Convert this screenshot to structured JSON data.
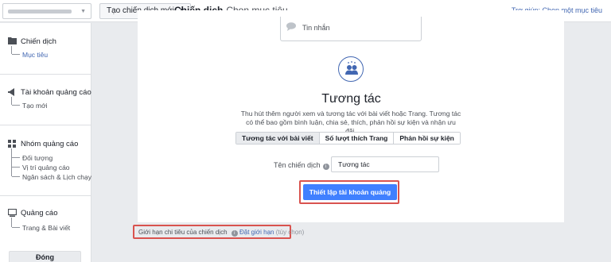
{
  "topbar": {
    "new_campaign_label": "Tạo chiến dịch mới",
    "campaign_bold": "Chiến dịch",
    "campaign_sub": "Chọn mục tiêu.",
    "help_link": "Trợ giúp: Chọn một mục tiêu"
  },
  "sidebar": {
    "campaign": {
      "title": "Chiến dịch",
      "items": [
        "Mục tiêu"
      ]
    },
    "ad_account": {
      "title": "Tài khoản quảng cáo",
      "items": [
        "Tạo mới"
      ]
    },
    "ad_set": {
      "title": "Nhóm quảng cáo",
      "items": [
        "Đối tượng",
        "Vị trí quảng cáo",
        "Ngân sách & Lịch chạy"
      ]
    },
    "ad": {
      "title": "Quảng cáo",
      "items": [
        "Trang & Bài viết"
      ]
    },
    "close_label": "Đóng"
  },
  "main": {
    "message_option": "Tin nhắn",
    "objective_title": "Tương tác",
    "objective_desc": "Thu hút thêm người xem và tương tác với bài viết hoặc Trang. Tương tác có thể bao gồm bình luận, chia sẻ, thích, phản hồi sự kiện và nhận ưu đãi.",
    "tabs": [
      "Tương tác với bài viết",
      "Số lượt thích Trang",
      "Phản hồi sự kiện"
    ],
    "campaign_name_label": "Tên chiến dịch",
    "campaign_name_value": "Tương tác",
    "setup_button": "Thiết lập tài khoản quảng cáo",
    "spend_limit_label": "Giới hạn chi tiêu của chiến dịch",
    "spend_limit_link": "Đặt giới hạn",
    "spend_limit_optional": "(tùy chọn)"
  },
  "colors": {
    "accent": "#4080ff",
    "link": "#4267b2",
    "highlight": "#d9534f"
  }
}
